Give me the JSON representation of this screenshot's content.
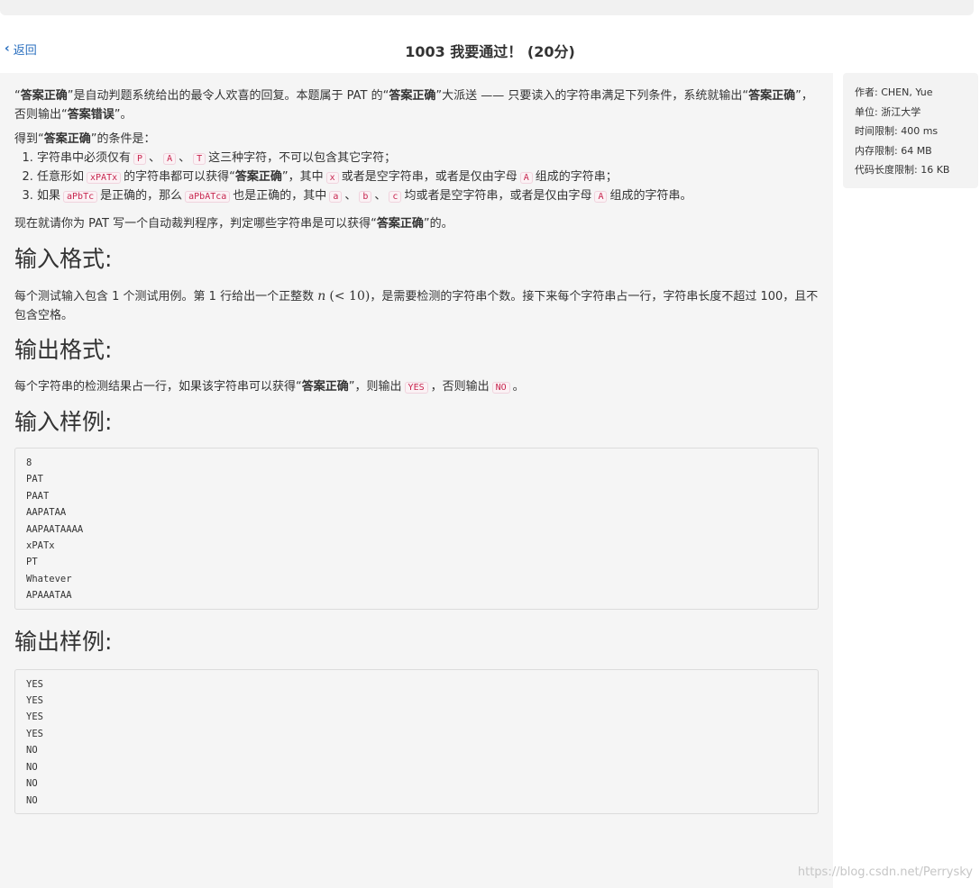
{
  "nav": {
    "back_label": "返回",
    "title": "1003 我要通过！ (20分)"
  },
  "intro": {
    "q_open": "“",
    "q_close": "”",
    "term": "答案正确",
    "line1_mid": "是自动判题系统给出的最令人欢喜的回复。本题属于 PAT 的",
    "line1_end": "大派送 —— 只要读入的字符串满足下列条件，系统就输出",
    "line1_tail_sep": "，否则输出",
    "error_term": "答案错误",
    "line1_end_punct": "。",
    "cond_lead": "得到",
    "cond_lead_end": "的条件是："
  },
  "conditions": [
    {
      "pre": "字符串中必须仅有",
      "codes": [
        "P",
        "A",
        "T"
      ],
      "post": "这三种字符，不可以包含其它字符；"
    },
    {
      "pre": "任意形如",
      "code_main": "xPATx",
      "mid": "的字符串都可以获得",
      "mid2": "，其中",
      "code_x": "x",
      "post": "或者是空字符串，或者是仅由字母",
      "code_a": "A",
      "post2": "组成的字符串；"
    },
    {
      "pre": "如果",
      "code1": "aPbTc",
      "mid1": "是正确的，那么",
      "code2": "aPbATca",
      "mid2": "也是正确的，其中",
      "codes": [
        "a",
        "b",
        "c"
      ],
      "post": "均或者是空字符串，或者是仅由字母",
      "code_a": "A",
      "post2": "组成的字符串。"
    }
  ],
  "task": {
    "pre": "现在就请你为 PAT 写一个自动裁判程序，判定哪些字符串是可以获得",
    "post": "的。"
  },
  "input_format": {
    "heading": "输入格式:",
    "text_a": "每个测试输入包含 1 个测试用例。第 1 行给出一个正整数",
    "math_var": "n",
    "math_rest": "(< 10)",
    "text_b": "，是需要检测的字符串个数。接下来每个字符串占一行，字符串长度不超过 100，且不包含空格。"
  },
  "output_format": {
    "heading": "输出格式:",
    "pre": "每个字符串的检测结果占一行，如果该字符串可以获得",
    "mid": "，则输出",
    "yes": "YES",
    "mid2": "，否则输出",
    "no": "NO",
    "end": "。"
  },
  "sample_input": {
    "heading": "输入样例:",
    "lines": [
      "8",
      "PAT",
      "PAAT",
      "AAPATAA",
      "AAPAATAAAA",
      "xPATx",
      "PT",
      "Whatever",
      "APAAATAA"
    ]
  },
  "sample_output": {
    "heading": "输出样例:",
    "lines": [
      "YES",
      "YES",
      "YES",
      "YES",
      "NO",
      "NO",
      "NO",
      "NO"
    ]
  },
  "sidebar": {
    "author": "作者: CHEN, Yue",
    "unit": "单位: 浙江大学",
    "time_limit": "时间限制: 400 ms",
    "memory_limit": "内存限制: 64 MB",
    "code_limit": "代码长度限制: 16 KB"
  },
  "watermark": "https://blog.csdn.net/Perrysky"
}
